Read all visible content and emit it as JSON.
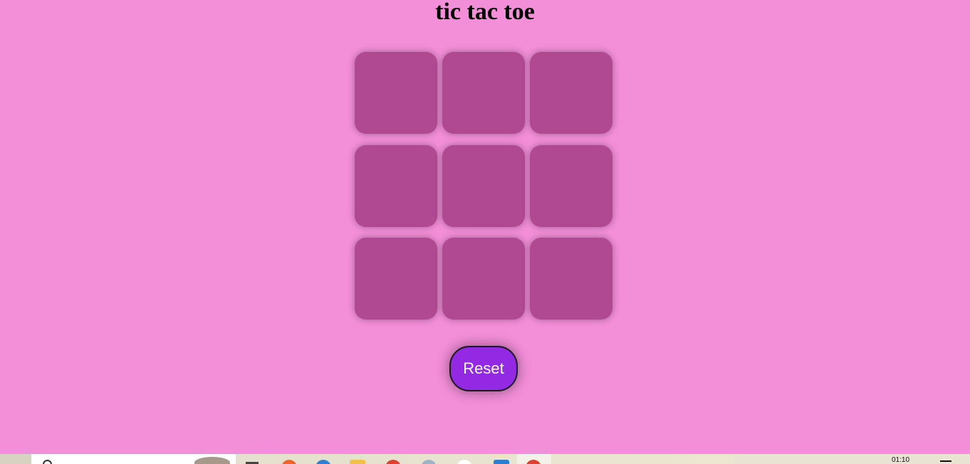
{
  "page": {
    "title": "tic tac toe"
  },
  "board": {
    "cells": [
      "",
      "",
      "",
      "",
      "",
      "",
      "",
      "",
      ""
    ]
  },
  "controls": {
    "reset_label": "Reset"
  },
  "taskbar": {
    "clock": "01:10",
    "apps": [
      "task-view-icon",
      "brave-browser-icon",
      "edge-browser-icon",
      "file-explorer-icon",
      "app-red-icon",
      "app-tool-icon",
      "chrome-icon",
      "vscode-icon",
      "active-app-icon"
    ]
  },
  "colors": {
    "background": "#f38ed9",
    "cell": "#b04992",
    "reset_button": "#9429e3"
  }
}
